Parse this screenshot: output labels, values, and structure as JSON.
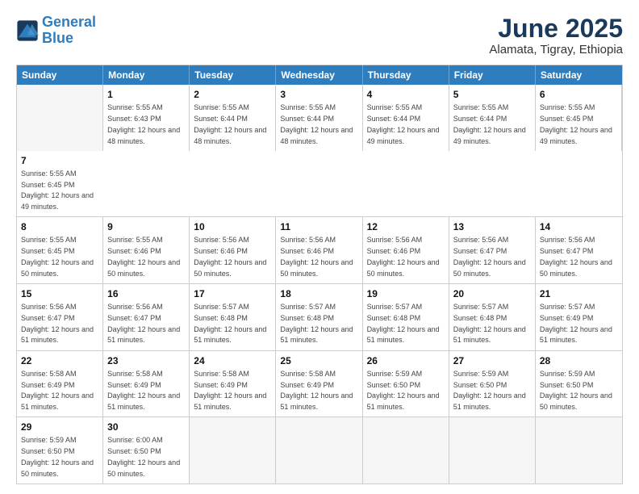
{
  "logo": {
    "line1": "General",
    "line2": "Blue"
  },
  "title": "June 2025",
  "subtitle": "Alamata, Tigray, Ethiopia",
  "days": [
    "Sunday",
    "Monday",
    "Tuesday",
    "Wednesday",
    "Thursday",
    "Friday",
    "Saturday"
  ],
  "rows": [
    [
      {
        "day": "",
        "empty": true
      },
      {
        "day": "1",
        "sunrise": "5:55 AM",
        "sunset": "6:43 PM",
        "daylight": "12 hours and 48 minutes."
      },
      {
        "day": "2",
        "sunrise": "5:55 AM",
        "sunset": "6:44 PM",
        "daylight": "12 hours and 48 minutes."
      },
      {
        "day": "3",
        "sunrise": "5:55 AM",
        "sunset": "6:44 PM",
        "daylight": "12 hours and 48 minutes."
      },
      {
        "day": "4",
        "sunrise": "5:55 AM",
        "sunset": "6:44 PM",
        "daylight": "12 hours and 49 minutes."
      },
      {
        "day": "5",
        "sunrise": "5:55 AM",
        "sunset": "6:44 PM",
        "daylight": "12 hours and 49 minutes."
      },
      {
        "day": "6",
        "sunrise": "5:55 AM",
        "sunset": "6:45 PM",
        "daylight": "12 hours and 49 minutes."
      },
      {
        "day": "7",
        "sunrise": "5:55 AM",
        "sunset": "6:45 PM",
        "daylight": "12 hours and 49 minutes."
      }
    ],
    [
      {
        "day": "8",
        "sunrise": "5:55 AM",
        "sunset": "6:45 PM",
        "daylight": "12 hours and 50 minutes."
      },
      {
        "day": "9",
        "sunrise": "5:55 AM",
        "sunset": "6:46 PM",
        "daylight": "12 hours and 50 minutes."
      },
      {
        "day": "10",
        "sunrise": "5:56 AM",
        "sunset": "6:46 PM",
        "daylight": "12 hours and 50 minutes."
      },
      {
        "day": "11",
        "sunrise": "5:56 AM",
        "sunset": "6:46 PM",
        "daylight": "12 hours and 50 minutes."
      },
      {
        "day": "12",
        "sunrise": "5:56 AM",
        "sunset": "6:46 PM",
        "daylight": "12 hours and 50 minutes."
      },
      {
        "day": "13",
        "sunrise": "5:56 AM",
        "sunset": "6:47 PM",
        "daylight": "12 hours and 50 minutes."
      },
      {
        "day": "14",
        "sunrise": "5:56 AM",
        "sunset": "6:47 PM",
        "daylight": "12 hours and 50 minutes."
      }
    ],
    [
      {
        "day": "15",
        "sunrise": "5:56 AM",
        "sunset": "6:47 PM",
        "daylight": "12 hours and 51 minutes."
      },
      {
        "day": "16",
        "sunrise": "5:56 AM",
        "sunset": "6:47 PM",
        "daylight": "12 hours and 51 minutes."
      },
      {
        "day": "17",
        "sunrise": "5:57 AM",
        "sunset": "6:48 PM",
        "daylight": "12 hours and 51 minutes."
      },
      {
        "day": "18",
        "sunrise": "5:57 AM",
        "sunset": "6:48 PM",
        "daylight": "12 hours and 51 minutes."
      },
      {
        "day": "19",
        "sunrise": "5:57 AM",
        "sunset": "6:48 PM",
        "daylight": "12 hours and 51 minutes."
      },
      {
        "day": "20",
        "sunrise": "5:57 AM",
        "sunset": "6:48 PM",
        "daylight": "12 hours and 51 minutes."
      },
      {
        "day": "21",
        "sunrise": "5:57 AM",
        "sunset": "6:49 PM",
        "daylight": "12 hours and 51 minutes."
      }
    ],
    [
      {
        "day": "22",
        "sunrise": "5:58 AM",
        "sunset": "6:49 PM",
        "daylight": "12 hours and 51 minutes."
      },
      {
        "day": "23",
        "sunrise": "5:58 AM",
        "sunset": "6:49 PM",
        "daylight": "12 hours and 51 minutes."
      },
      {
        "day": "24",
        "sunrise": "5:58 AM",
        "sunset": "6:49 PM",
        "daylight": "12 hours and 51 minutes."
      },
      {
        "day": "25",
        "sunrise": "5:58 AM",
        "sunset": "6:49 PM",
        "daylight": "12 hours and 51 minutes."
      },
      {
        "day": "26",
        "sunrise": "5:59 AM",
        "sunset": "6:50 PM",
        "daylight": "12 hours and 51 minutes."
      },
      {
        "day": "27",
        "sunrise": "5:59 AM",
        "sunset": "6:50 PM",
        "daylight": "12 hours and 51 minutes."
      },
      {
        "day": "28",
        "sunrise": "5:59 AM",
        "sunset": "6:50 PM",
        "daylight": "12 hours and 50 minutes."
      }
    ],
    [
      {
        "day": "29",
        "sunrise": "5:59 AM",
        "sunset": "6:50 PM",
        "daylight": "12 hours and 50 minutes."
      },
      {
        "day": "30",
        "sunrise": "6:00 AM",
        "sunset": "6:50 PM",
        "daylight": "12 hours and 50 minutes."
      },
      {
        "day": "",
        "empty": true
      },
      {
        "day": "",
        "empty": true
      },
      {
        "day": "",
        "empty": true
      },
      {
        "day": "",
        "empty": true
      },
      {
        "day": "",
        "empty": true
      }
    ]
  ]
}
